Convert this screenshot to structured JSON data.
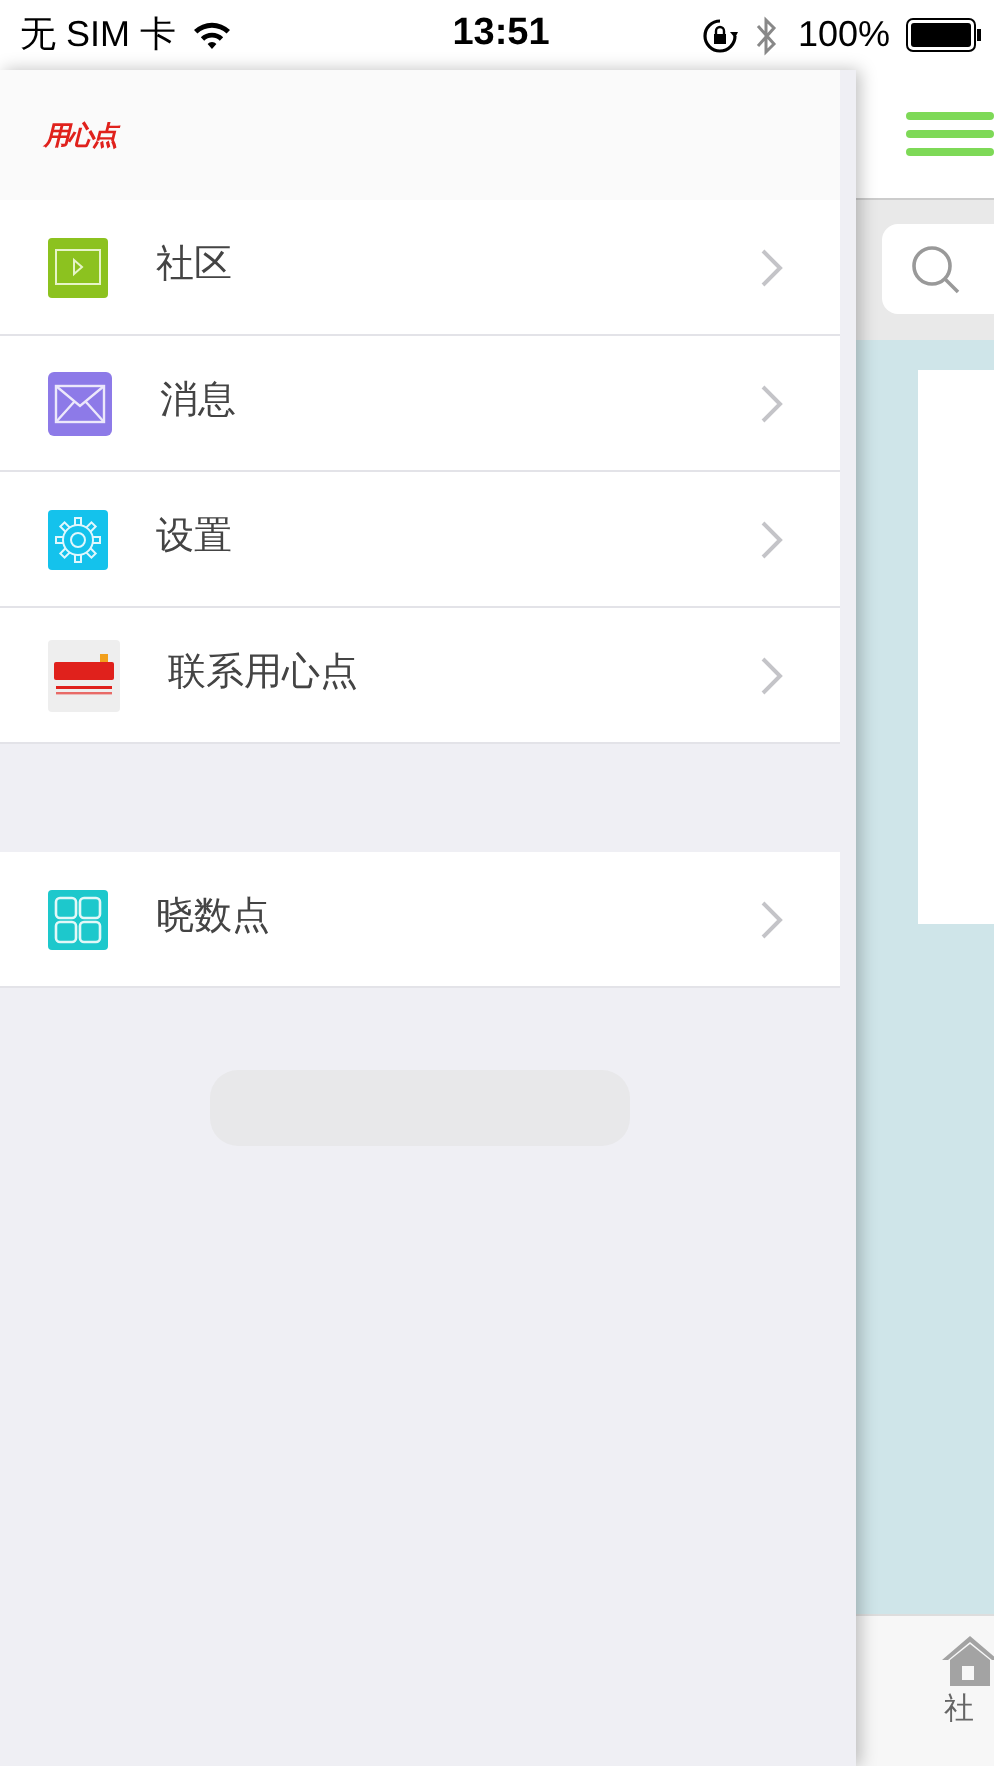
{
  "status_bar": {
    "carrier": "无 SIM 卡",
    "time": "13:51",
    "battery": "100%"
  },
  "drawer": {
    "logo": "用心点",
    "groups": [
      {
        "items": [
          {
            "kind": "tv",
            "label": "社区"
          },
          {
            "kind": "mail",
            "label": "消息"
          },
          {
            "kind": "gear",
            "label": "设置"
          },
          {
            "kind": "logo",
            "label": "联系用心点"
          }
        ]
      },
      {
        "items": [
          {
            "kind": "grid",
            "label": "晓数点"
          }
        ]
      }
    ]
  },
  "main": {
    "tab_bar": [
      {
        "label": "社"
      }
    ]
  }
}
